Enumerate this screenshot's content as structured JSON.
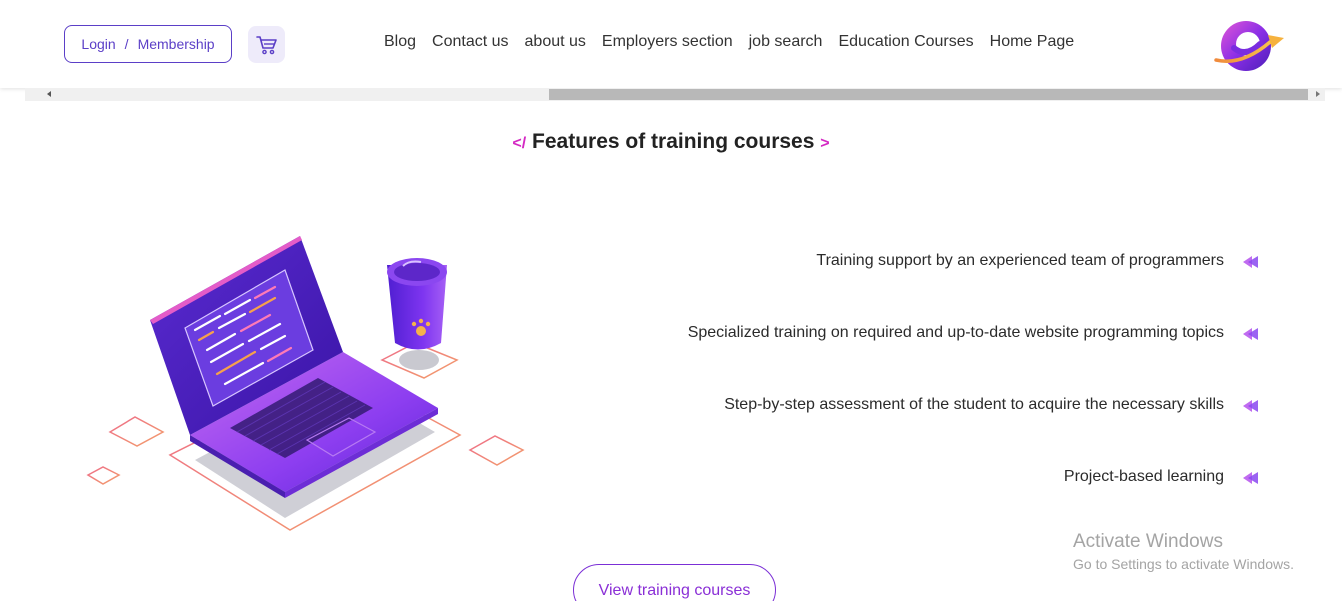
{
  "header": {
    "login_label": "Login",
    "separator": "/",
    "membership_label": "Membership",
    "cart_icon": "shopping-cart-icon",
    "logo_icon": "brand-swirl-logo",
    "nav": [
      {
        "label": "Blog"
      },
      {
        "label": "Contact us"
      },
      {
        "label": "about us"
      },
      {
        "label": "Employers section"
      },
      {
        "label": "job search"
      },
      {
        "label": "Education Courses"
      },
      {
        "label": "Home Page"
      }
    ]
  },
  "section": {
    "tag_open": "</",
    "title": "Features of training courses",
    "tag_close": ">"
  },
  "features": [
    {
      "text": "Training support by an experienced team of programmers",
      "icon": "pointer-arrow-icon"
    },
    {
      "text": "Specialized training on required and up-to-date website programming topics",
      "icon": "pointer-arrow-icon"
    },
    {
      "text": "Step-by-step assessment of the student to acquire the necessary skills",
      "icon": "pointer-arrow-icon"
    },
    {
      "text": "Project-based learning",
      "icon": "pointer-arrow-icon"
    }
  ],
  "cta": {
    "label": "View training courses"
  },
  "watermark": {
    "line1": "Activate Windows",
    "line2": "Go to Settings to activate Windows."
  },
  "colors": {
    "primary": "#5b3fc7",
    "accent": "#d428c3",
    "cta_text": "#8a2fd6"
  }
}
